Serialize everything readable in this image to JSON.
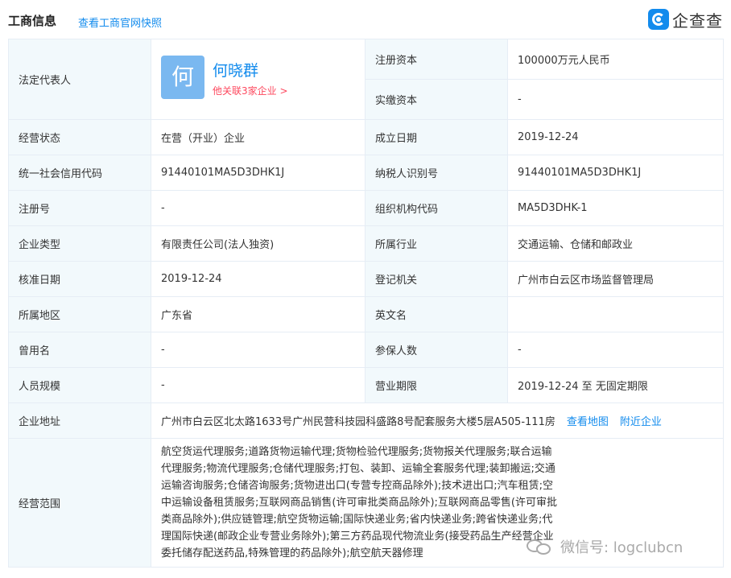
{
  "header": {
    "title": "工商信息",
    "snapshot_link": "查看工商官网快照",
    "brand": "企查查"
  },
  "legal_rep": {
    "label": "法定代表人",
    "avatar_char": "何",
    "name": "何晓群",
    "related": "他关联3家企业 >"
  },
  "rows": {
    "reg_capital": {
      "label": "注册资本",
      "value": "100000万元人民币"
    },
    "paid_capital": {
      "label": "实缴资本",
      "value": "-"
    },
    "status": {
      "label": "经营状态",
      "value": "在营（开业）企业"
    },
    "founded": {
      "label": "成立日期",
      "value": "2019-12-24"
    },
    "credit_code": {
      "label": "统一社会信用代码",
      "value": "91440101MA5D3DHK1J"
    },
    "taxpayer_id": {
      "label": "纳税人识别号",
      "value": "91440101MA5D3DHK1J"
    },
    "reg_no": {
      "label": "注册号",
      "value": "-"
    },
    "org_code": {
      "label": "组织机构代码",
      "value": "MA5D3DHK-1"
    },
    "company_type": {
      "label": "企业类型",
      "value": "有限责任公司(法人独资)"
    },
    "industry": {
      "label": "所属行业",
      "value": "交通运输、仓储和邮政业"
    },
    "approval_date": {
      "label": "核准日期",
      "value": "2019-12-24"
    },
    "authority": {
      "label": "登记机关",
      "value": "广州市白云区市场监督管理局"
    },
    "region": {
      "label": "所属地区",
      "value": "广东省"
    },
    "english_name": {
      "label": "英文名",
      "value": ""
    },
    "former_name": {
      "label": "曾用名",
      "value": "-"
    },
    "insured": {
      "label": "参保人数",
      "value": "-"
    },
    "staff_size": {
      "label": "人员规模",
      "value": "-"
    },
    "term": {
      "label": "营业期限",
      "value": "2019-12-24 至 无固定期限"
    }
  },
  "address": {
    "label": "企业地址",
    "value": "广州市白云区北太路1633号广州民营科技园科盛路8号配套服务大楼5层A505-111房",
    "map_link": "查看地图",
    "nearby_link": "附近企业"
  },
  "scope": {
    "label": "经营范围",
    "value": "航空货运代理服务;道路货物运输代理;货物检验代理服务;货物报关代理服务;联合运输代理服务;物流代理服务;仓储代理服务;打包、装卸、运输全套服务代理;装卸搬运;交通运输咨询服务;仓储咨询服务;货物进出口(专营专控商品除外);技术进出口;汽车租赁;空中运输设备租赁服务;互联网商品销售(许可审批类商品除外);互联网商品零售(许可审批类商品除外);供应链管理;航空货物运输;国际快递业务;省内快递业务;跨省快递业务;代理国际快递(邮政企业专营业务除外);第三方药品现代物流业务(接受药品生产经营企业委托储存配送药品,特殊管理的药品除外);航空航天器修理"
  },
  "watermark": {
    "text": "微信号: logclubcn"
  },
  "colors": {
    "accent": "#128bed",
    "label_bg": "#f2f9fc",
    "border": "#e6edf5",
    "related_red": "#fd485e",
    "avatar_bg": "#7ab8f0"
  }
}
